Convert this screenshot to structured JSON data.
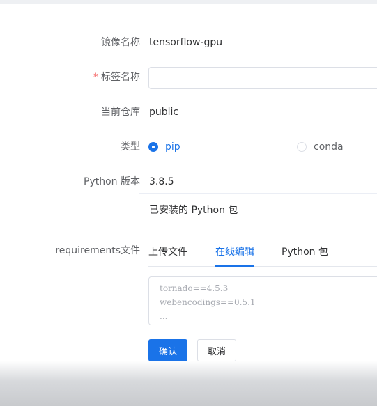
{
  "form": {
    "image_name": {
      "label": "镜像名称",
      "value": "tensorflow-gpu"
    },
    "tag_name": {
      "required_mark": "*",
      "label": "标签名称",
      "value": "",
      "placeholder": ""
    },
    "repository": {
      "label": "当前仓库",
      "value": "public"
    },
    "type": {
      "label": "类型",
      "options": [
        {
          "label": "pip",
          "checked": true
        },
        {
          "label": "conda",
          "checked": false
        }
      ]
    },
    "python_version": {
      "label": "Python 版本",
      "value": "3.8.5"
    },
    "installed_packages": {
      "title": "已安装的 Python 包"
    },
    "requirements": {
      "label": "requirements文件",
      "tabs": [
        {
          "label": "上传文件",
          "active": false
        },
        {
          "label": "在线编辑",
          "active": true
        },
        {
          "label": "Python 包",
          "active": false
        }
      ],
      "editor_placeholder": "tornado==4.5.3\nwebencodings==0.5.1\n..."
    },
    "actions": {
      "confirm": "确认",
      "cancel": "取消"
    }
  },
  "colors": {
    "primary": "#1a73e8",
    "required": "#f56c6c",
    "border": "#dcdfe6"
  }
}
